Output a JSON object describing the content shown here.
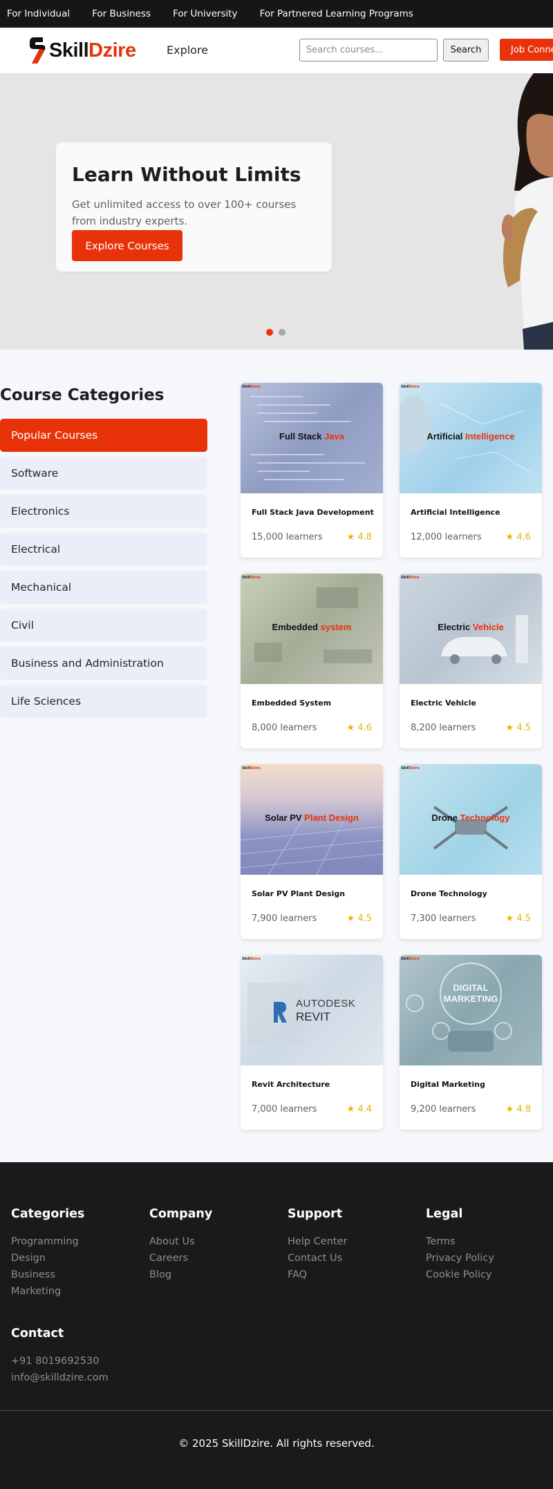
{
  "topbar": {
    "links": [
      "For Individual",
      "For Business",
      "For University",
      "For Partnered Learning Programs"
    ]
  },
  "header": {
    "logo_part1": "Skill",
    "logo_part2": "Dzire",
    "explore_label": "Explore",
    "search_placeholder": "Search courses...",
    "search_button": "Search",
    "job_button": "Job Connect"
  },
  "hero": {
    "title": "Learn Without Limits",
    "subtitle": "Get unlimited access to over 100+ courses from industry experts.",
    "cta": "Explore Courses",
    "slides": 2,
    "active_slide": 1
  },
  "categories": {
    "title": "Course Categories",
    "items": [
      "Popular Courses",
      "Software",
      "Electronics",
      "Electrical",
      "Mechanical",
      "Civil",
      "Business and Administration",
      "Life Sciences"
    ],
    "active": "Popular Courses"
  },
  "courses": [
    {
      "title": "Full Stack Java Development",
      "thumb_text": "Full Stack",
      "thumb_highlight": "Java",
      "learners": "15,000 learners",
      "rating": "★ 4.8"
    },
    {
      "title": "Artificial Intelligence",
      "thumb_text": "Artificial",
      "thumb_highlight": "Intelligence",
      "learners": "12,000 learners",
      "rating": "★ 4.6"
    },
    {
      "title": "Embedded System",
      "thumb_text": "Embedded",
      "thumb_highlight": "system",
      "learners": "8,000 learners",
      "rating": "★ 4.6"
    },
    {
      "title": "Electric Vehicle",
      "thumb_text": "Electric",
      "thumb_highlight": "Vehicle",
      "learners": "8,200 learners",
      "rating": "★ 4.5"
    },
    {
      "title": "Solar PV Plant Design",
      "thumb_text": "Solar PV",
      "thumb_highlight": "Plant Design",
      "learners": "7,900 learners",
      "rating": "★ 4.5"
    },
    {
      "title": "Drone Technology",
      "thumb_text": "Drone",
      "thumb_highlight": "Technology",
      "learners": "7,300 learners",
      "rating": "★ 4.5"
    },
    {
      "title": "Revit Architecture",
      "thumb_text": "AUTODESK",
      "thumb_highlight": "REVIT",
      "learners": "7,000 learners",
      "rating": "★ 4.4"
    },
    {
      "title": "Digital Marketing",
      "thumb_text": "DIGITAL",
      "thumb_highlight": "MARKETING",
      "learners": "9,200 learners",
      "rating": "★ 4.8"
    }
  ],
  "footer": {
    "columns": [
      {
        "heading": "Categories",
        "links": [
          "Programming",
          "Design",
          "Business",
          "Marketing"
        ]
      },
      {
        "heading": "Company",
        "links": [
          "About Us",
          "Careers",
          "Blog"
        ]
      },
      {
        "heading": "Support",
        "links": [
          "Help Center",
          "Contact Us",
          "FAQ"
        ]
      },
      {
        "heading": "Legal",
        "links": [
          "Terms",
          "Privacy Policy",
          "Cookie Policy"
        ]
      }
    ],
    "contact": {
      "heading": "Contact",
      "phone": "+91 8019692530",
      "email": "info@skilldzire.com"
    },
    "copyright": "© 2025 SkillDzire. All rights reserved."
  },
  "colors": {
    "brand": "#e8330a",
    "dark": "#161616",
    "rating": "#e8b400"
  },
  "icons": [
    "skilldzire-logo-icon",
    "star-icon"
  ]
}
